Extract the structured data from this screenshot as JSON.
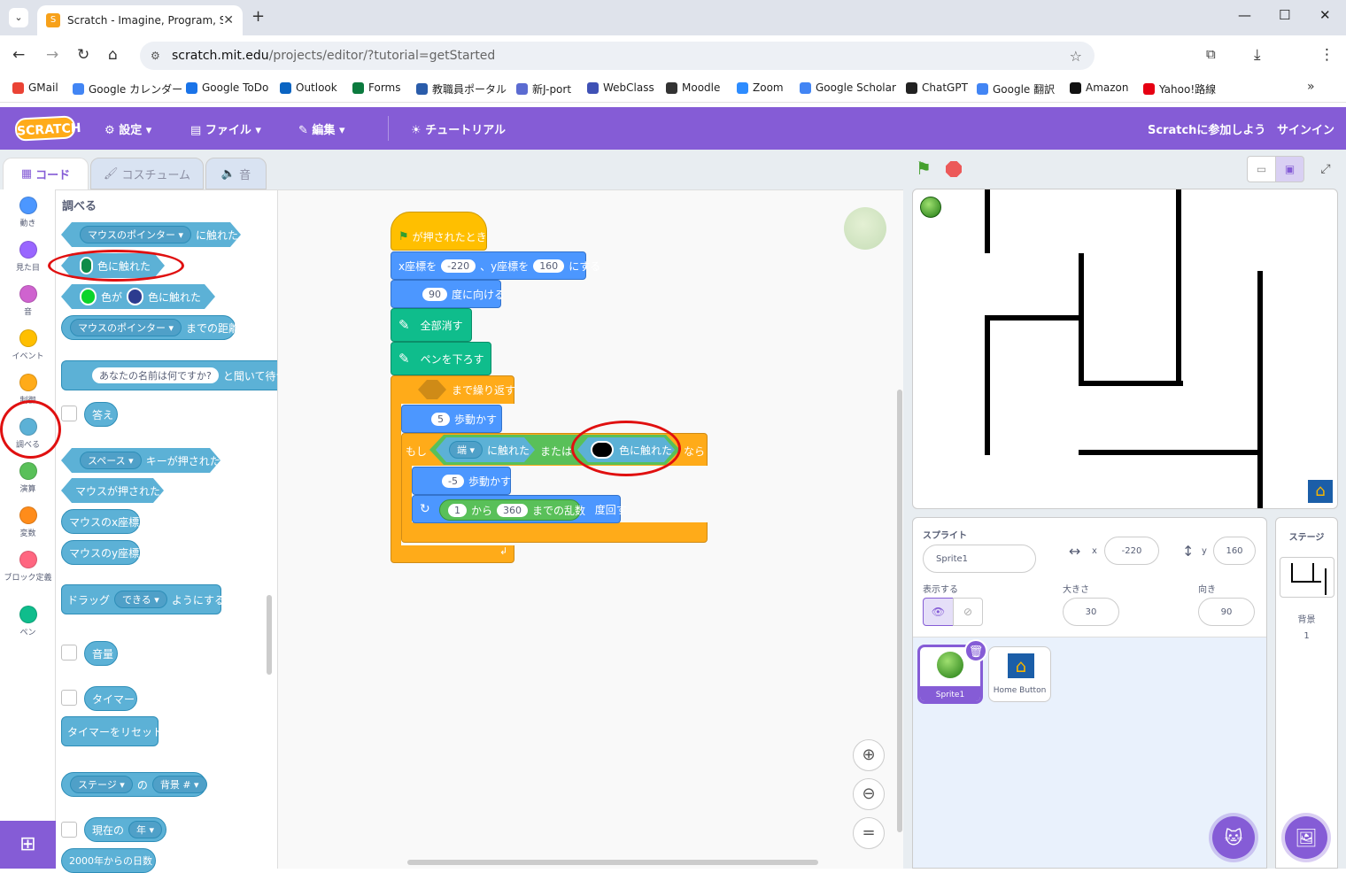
{
  "browser": {
    "tab_title": "Scratch - Imagine, Program, Sha",
    "url_domain": "scratch.mit.edu",
    "url_path": "/projects/editor/?tutorial=getStarted",
    "bookmarks": [
      "GMail",
      "Google カレンダー",
      "Google ToDo",
      "Outlook",
      "Forms",
      "教職員ポータル",
      "新J-port",
      "WebClass",
      "Moodle",
      "Zoom",
      "Google Scholar",
      "ChatGPT",
      "Google 翻訳",
      "Amazon",
      "Yahoo!路線"
    ]
  },
  "menubar": {
    "logo": "SCRATCH",
    "settings": "設定",
    "file": "ファイル",
    "edit": "編集",
    "tutorial": "チュートリアル",
    "join": "Scratchに参加しよう",
    "signin": "サインイン"
  },
  "editor_tabs": {
    "code": "コード",
    "costume": "コスチューム",
    "sound": "音"
  },
  "categories": [
    {
      "label": "動き",
      "color": "#4c97ff"
    },
    {
      "label": "見た目",
      "color": "#9966ff"
    },
    {
      "label": "音",
      "color": "#cf63cf"
    },
    {
      "label": "イベント",
      "color": "#ffbf00"
    },
    {
      "label": "制御",
      "color": "#ffab19"
    },
    {
      "label": "調べる",
      "color": "#5cb1d6"
    },
    {
      "label": "演算",
      "color": "#59c059"
    },
    {
      "label": "変数",
      "color": "#ff8c1a"
    },
    {
      "label": "ブロック定義",
      "color": "#ff6680"
    },
    {
      "label": "ペン",
      "color": "#0fbd8c"
    }
  ],
  "palette": {
    "heading": "調べる",
    "touching_pointer_dd": "マウスのポインター",
    "touching_suffix": "に触れた",
    "touching_color": "色に触れた",
    "color_is": "色が",
    "color_touching": "色に触れた",
    "distance_dd": "マウスのポインター",
    "distance_suffix": "までの距離",
    "ask_text": "あなたの名前は何ですか?",
    "ask_suffix": "と聞いて待つ",
    "answer": "答え",
    "key_dd": "スペース",
    "key_suffix": "キーが押された",
    "mouse_down": "マウスが押された",
    "mouse_x": "マウスのx座標",
    "mouse_y": "マウスのy座標",
    "drag_prefix": "ドラッグ",
    "drag_dd": "できる",
    "drag_suffix": "ようにする",
    "loudness": "音量",
    "timer": "タイマー",
    "reset_timer": "タイマーをリセット",
    "of_dd1": "ステージ",
    "of_mid": "の",
    "of_dd2": "背景 #",
    "current_prefix": "現在の",
    "current_dd": "年",
    "days_since": "2000年からの日数"
  },
  "script": {
    "when_flag": "が押されたとき",
    "goto_x_label": "x座標を",
    "goto_x": "-220",
    "goto_y_label": "、y座標を",
    "goto_y": "160",
    "goto_suffix": "にする",
    "point_dir": "90",
    "point_suffix": "度に向ける",
    "clear": "全部消す",
    "pen_down": "ペンを下ろす",
    "repeat_until": "まで繰り返す",
    "move1": "5",
    "move_suffix": "歩動かす",
    "if_label": "もし",
    "edge_dd": "端",
    "touching_suffix": "に触れた",
    "or_label": "または",
    "touching_color": "色に触れた",
    "then_label": "なら",
    "move2": "-5",
    "move2_suffix": "歩動かす",
    "rand_from": "1",
    "rand_mid": "から",
    "rand_to": "360",
    "rand_suffix": "までの乱数",
    "turn_suffix": "度回す"
  },
  "sprite_info": {
    "sprite_label": "スプライト",
    "sprite_name": "Sprite1",
    "x_label": "x",
    "x": "-220",
    "y_label": "y",
    "y": "160",
    "show_label": "表示する",
    "size_label": "大きさ",
    "size": "30",
    "direction_label": "向き",
    "direction": "90"
  },
  "sprites": [
    {
      "name": "Sprite1"
    },
    {
      "name": "Home Button"
    }
  ],
  "stage_pane": {
    "label": "ステージ",
    "backdrops_label": "背景",
    "backdrops_count": "1"
  },
  "colors": {
    "accent": "#855cd6",
    "sensing": "#5cb1d6",
    "touch_color1": "#0e8c48",
    "touch_color2": "#000000",
    "color_is_a": "#0bd42a",
    "color_is_b": "#2c3b8f"
  }
}
